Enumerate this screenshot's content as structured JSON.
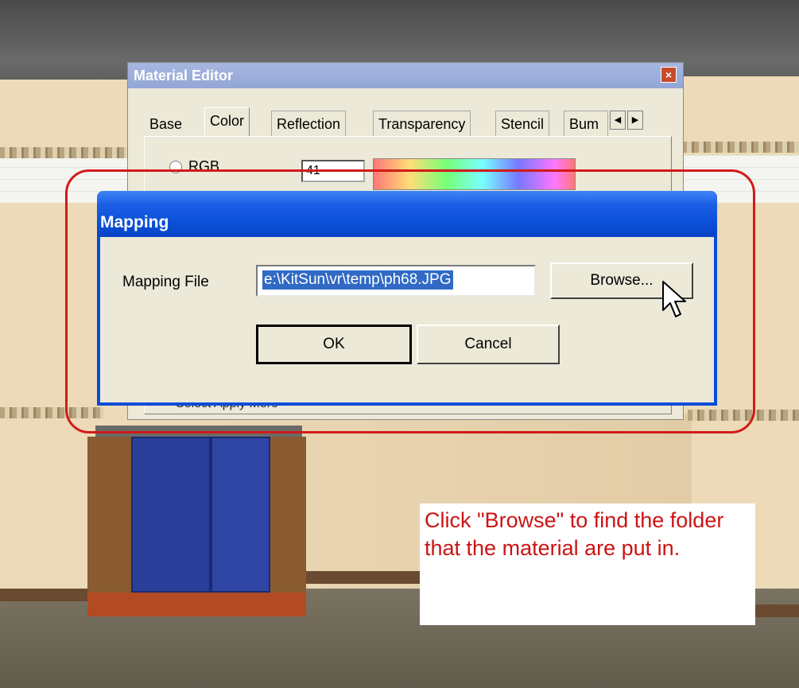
{
  "material_editor": {
    "title": "Material Editor",
    "close_glyph": "×",
    "tabs": [
      {
        "label": "Base",
        "active": false
      },
      {
        "label": "Color",
        "active": true
      },
      {
        "label": "Reflection",
        "active": false
      },
      {
        "label": "Transparency",
        "active": false
      },
      {
        "label": "Stencil",
        "active": false
      },
      {
        "label": "Bum",
        "active": false
      }
    ],
    "tab_scroll_left": "◀",
    "tab_scroll_right": "▶",
    "color_mode_label": "RGB",
    "rgb_value": "41",
    "bottom_partial_text": "Select    Apply    More"
  },
  "mapping_dialog": {
    "title": "Mapping",
    "file_label": "Mapping File",
    "file_value": "e:\\KitSun\\vr\\temp\\ph68.JPG",
    "browse_label": "Browse...",
    "ok_label": "OK",
    "cancel_label": "Cancel"
  },
  "annotation": {
    "text": "Click \"Browse\" to find the folder that the material are put in."
  },
  "colors": {
    "titlebar_blue": "#0a4cd8",
    "dialog_bg": "#ece9d8",
    "highlight_red": "#d21a1a",
    "selection_blue": "#316ac5"
  }
}
